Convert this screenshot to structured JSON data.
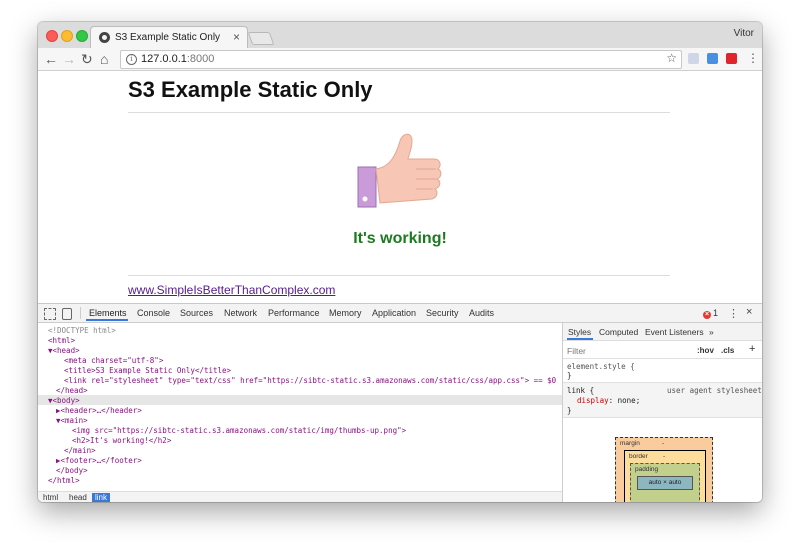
{
  "browser": {
    "tab_title": "S3 Example Static Only",
    "profile_name": "Vitor",
    "url_host": "127.0.0.1",
    "url_port": ":8000"
  },
  "page": {
    "title": "S3 Example Static Only",
    "message": "It's working!",
    "footer_link": "www.SimpleIsBetterThanComplex.com",
    "message_color": "#1c7a20",
    "image": "thumbs-up-icon"
  },
  "devtools": {
    "tabs": [
      "Elements",
      "Console",
      "Sources",
      "Network",
      "Performance",
      "Memory",
      "Application",
      "Security",
      "Audits"
    ],
    "active_tab": "Elements",
    "error_count": "1",
    "code": [
      "<!DOCTYPE html>",
      "<html>",
      "▼<head>",
      "<meta charset=\"utf-8\">",
      "<title>S3 Example Static Only</title>",
      "<link rel=\"stylesheet\" type=\"text/css\" href=\"https://sibtc-static.s3.amazonaws.com/static/css/app.css\"> == $0",
      "</head>",
      "▼<body>",
      "▶<header>…</header>",
      "▼<main>",
      "<img src=\"https://sibtc-static.s3.amazonaws.com/static/img/thumbs-up.png\">",
      "<h2>It's working!</h2>",
      "</main>",
      "▶<footer>…</footer>",
      "</body>",
      "</html>"
    ],
    "breadcrumbs": [
      "html",
      "head",
      "link"
    ],
    "styles": {
      "tabs": [
        "Styles",
        "Computed",
        "Event Listeners",
        "»"
      ],
      "filter_placeholder": "Filter",
      "hov": ":hov",
      "cls": ".cls",
      "plus": "+",
      "element_style_open": "element.style {",
      "element_style_close": "}",
      "ua_selector": "link {",
      "ua_source": "user agent stylesheet",
      "ua_property": "display",
      "ua_value": "none;",
      "ua_close": "}",
      "box_margin": "margin",
      "box_border": "border",
      "box_padding": "padding",
      "box_content": "auto × auto",
      "dash": "-"
    }
  }
}
